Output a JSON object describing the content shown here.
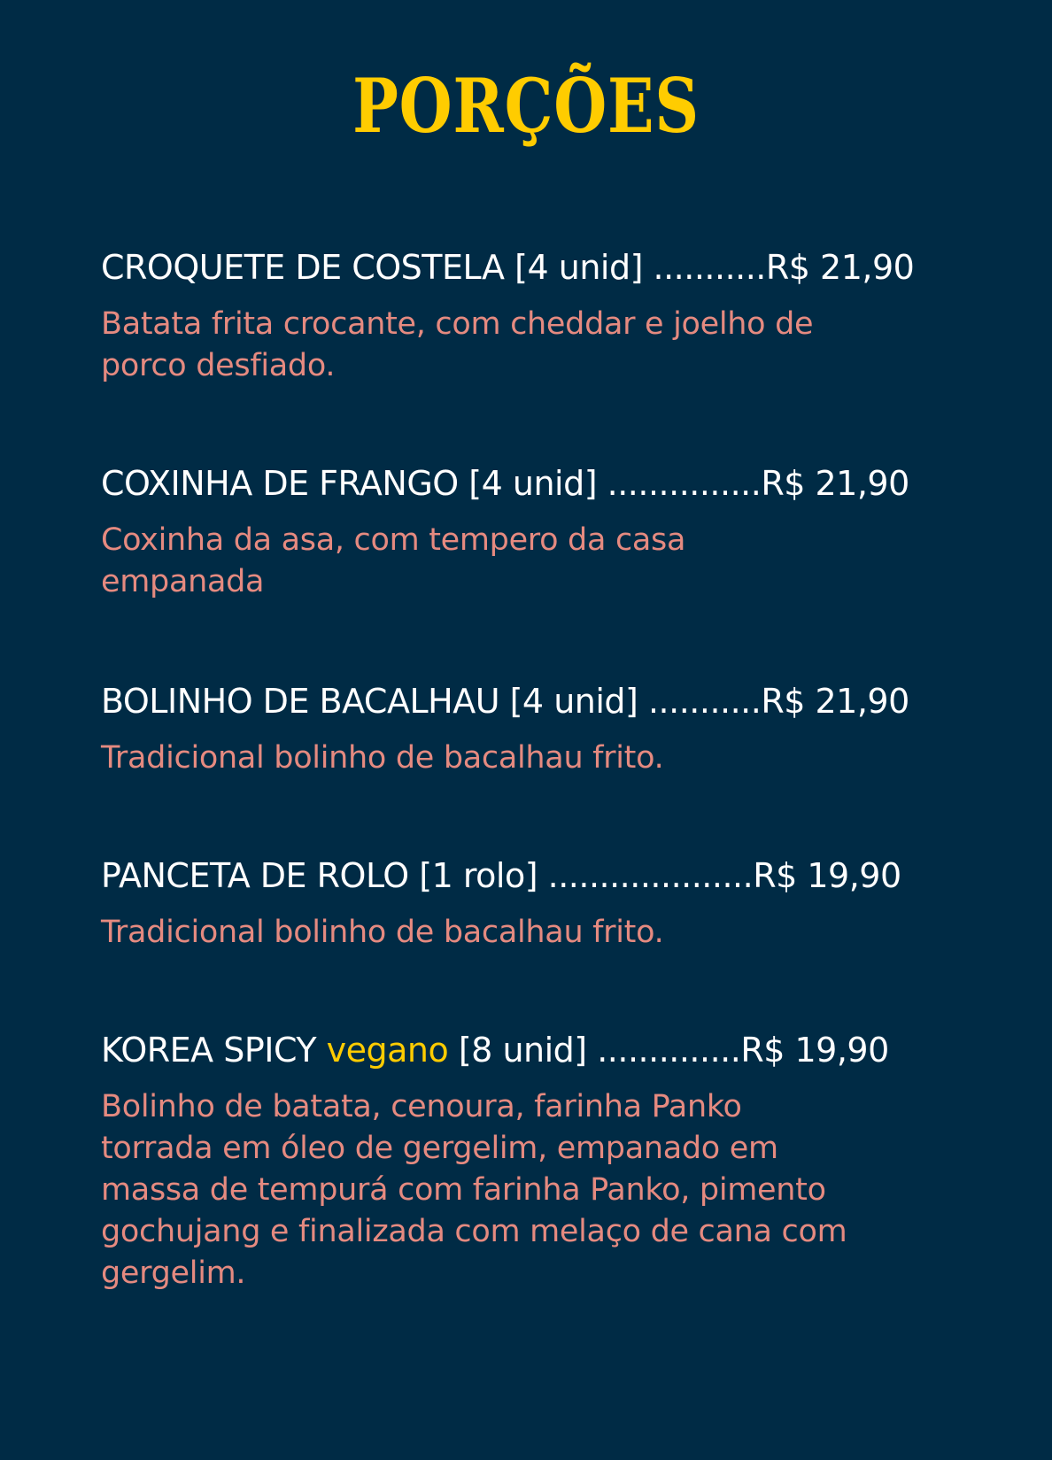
{
  "header": {
    "title": "PORÇÕES"
  },
  "colors": {
    "background": "#002b45",
    "title": "#ffcc00",
    "item_name": "#ffffff",
    "description": "#e58a80",
    "tag": "#ffcc00"
  },
  "menu": {
    "items": [
      {
        "name": "CROQUETE DE COSTELA",
        "tag": "",
        "quantity": "[4 unid]",
        "leader": "...........",
        "price": "R$ 21,90",
        "description_lines": [
          "Batata frita crocante, com cheddar e joelho de",
          "porco desfiado."
        ]
      },
      {
        "name": "COXINHA DE FRANGO",
        "tag": "",
        "quantity": "[4 unid]",
        "leader": "...............",
        "price": "R$ 21,90",
        "description_lines": [
          "Coxinha da asa, com tempero da casa",
          "empanada"
        ]
      },
      {
        "name": "BOLINHO DE BACALHAU",
        "tag": "",
        "quantity": "[4 unid]",
        "leader": "...........",
        "price": "R$ 21,90",
        "description_lines": [
          "Tradicional bolinho de bacalhau frito."
        ]
      },
      {
        "name": "PANCETA DE ROLO",
        "tag": "",
        "quantity": "[1 rolo]",
        "leader": "....................",
        "price": "R$ 19,90",
        "description_lines": [
          "Tradicional bolinho de bacalhau frito."
        ]
      },
      {
        "name": "KOREA SPICY",
        "tag": "vegano",
        "quantity": "[8 unid]",
        "leader": "..............",
        "price": "R$ 19,90",
        "description_lines": [
          "Bolinho de batata, cenoura, farinha Panko",
          "torrada em óleo de gergelim, empanado em",
          "massa de tempurá com farinha Panko, pimento",
          "gochujang e finalizada com melaço de cana com",
          "gergelim."
        ]
      }
    ]
  }
}
